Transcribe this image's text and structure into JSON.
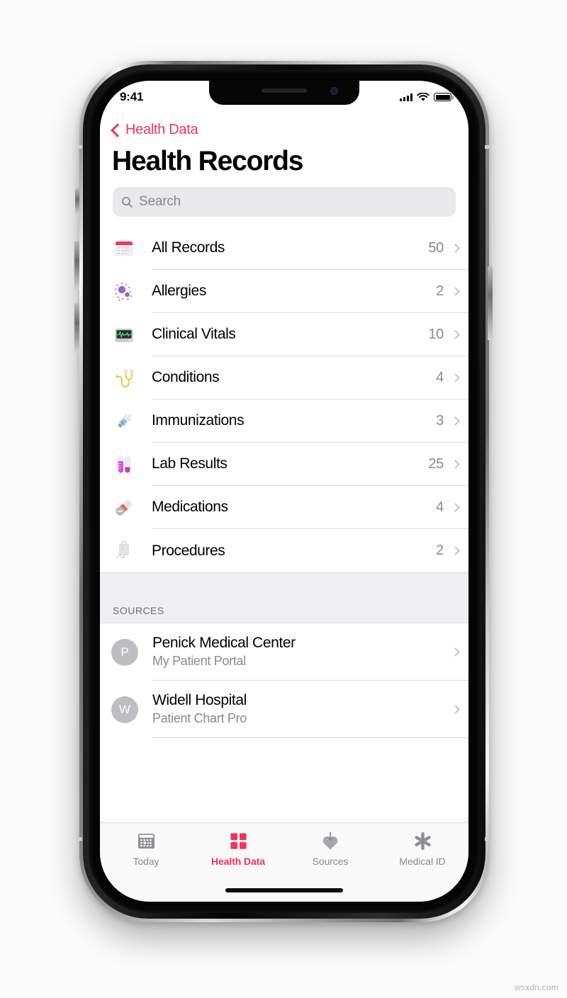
{
  "watermark": "wsxdn.com",
  "status_bar": {
    "time": "9:41",
    "signal_icon": "cellular-signal-icon",
    "wifi_icon": "wifi-icon",
    "battery_icon": "battery-full-icon"
  },
  "nav": {
    "back_label": "Health Data",
    "back_icon": "chevron-left-icon",
    "title": "Health Records",
    "accent_color": "#F5325B"
  },
  "search": {
    "placeholder": "Search",
    "icon": "search-icon"
  },
  "records": {
    "items": [
      {
        "label": "All Records",
        "count": "50",
        "icon": "records-document-icon"
      },
      {
        "label": "Allergies",
        "count": "2",
        "icon": "allergen-particles-icon"
      },
      {
        "label": "Clinical Vitals",
        "count": "10",
        "icon": "vitals-monitor-icon"
      },
      {
        "label": "Conditions",
        "count": "4",
        "icon": "stethoscope-icon"
      },
      {
        "label": "Immunizations",
        "count": "3",
        "icon": "syringe-icon"
      },
      {
        "label": "Lab Results",
        "count": "25",
        "icon": "test-tubes-icon"
      },
      {
        "label": "Medications",
        "count": "4",
        "icon": "pills-capsule-icon"
      },
      {
        "label": "Procedures",
        "count": "2",
        "icon": "iv-bag-icon"
      }
    ]
  },
  "sources": {
    "header": "SOURCES",
    "items": [
      {
        "initial": "P",
        "title": "Penick Medical Center",
        "subtitle": "My Patient Portal"
      },
      {
        "initial": "W",
        "title": "Widell Hospital",
        "subtitle": "Patient Chart Pro"
      }
    ]
  },
  "tabbar": {
    "items": [
      {
        "label": "Today",
        "icon": "calendar-icon",
        "active": false
      },
      {
        "label": "Health Data",
        "icon": "four-squares-icon",
        "active": true
      },
      {
        "label": "Sources",
        "icon": "heart-download-icon",
        "active": false
      },
      {
        "label": "Medical ID",
        "icon": "asterisk-icon",
        "active": false
      }
    ]
  }
}
